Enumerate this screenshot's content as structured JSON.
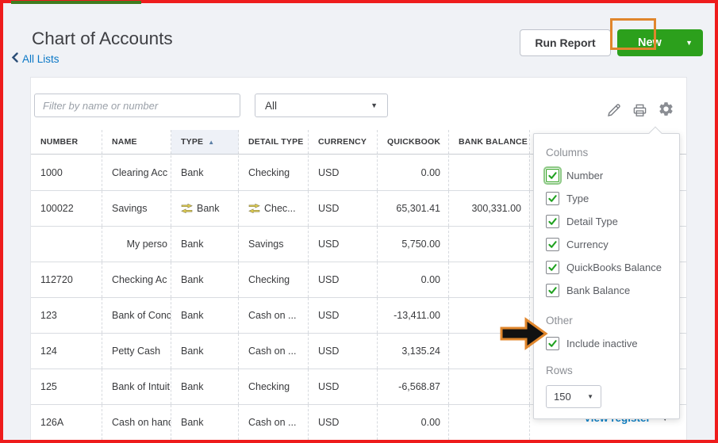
{
  "header": {
    "title": "Chart of Accounts",
    "back_label": "All Lists"
  },
  "toolbar": {
    "run_report_label": "Run Report",
    "new_label": "New"
  },
  "filter_bar": {
    "search_placeholder": "Filter by name or number",
    "filter_select_value": "All"
  },
  "icons": {
    "pencil": "pencil-icon",
    "printer": "printer-icon",
    "gear": "gear-icon",
    "select_arrow": "▼",
    "new_button_arrow": "▼",
    "sort_asc": "▲",
    "view_register_arrow": "▼",
    "rows_select_arrow": "▼"
  },
  "table": {
    "columns": [
      "NUMBER",
      "NAME",
      "TYPE",
      "DETAIL TYPE",
      "CURRENCY",
      "QUICKBOOK",
      "BANK BALANCE"
    ],
    "sorted_column": "TYPE",
    "sort_direction": "asc",
    "rows": [
      {
        "number": "1000",
        "name": "Clearing Acc",
        "type": "Bank",
        "type_synced": false,
        "detail_type": "Checking",
        "detail_synced": false,
        "currency": "USD",
        "quickbooks_balance": "0.00",
        "bank_balance": ""
      },
      {
        "number": "100022",
        "name": "Savings",
        "type": "Bank",
        "type_synced": true,
        "detail_type": "Chec...",
        "detail_synced": true,
        "currency": "USD",
        "quickbooks_balance": "65,301.41",
        "bank_balance": "300,331.00"
      },
      {
        "number": "",
        "name": "My perso",
        "name_align": "right",
        "type": "Bank",
        "type_synced": false,
        "detail_type": "Savings",
        "detail_synced": false,
        "currency": "USD",
        "quickbooks_balance": "5,750.00",
        "bank_balance": ""
      },
      {
        "number": "112720",
        "name": "Checking Ac",
        "type": "Bank",
        "type_synced": false,
        "detail_type": "Checking",
        "detail_synced": false,
        "currency": "USD",
        "quickbooks_balance": "0.00",
        "bank_balance": ""
      },
      {
        "number": "123",
        "name": "Bank of Conc",
        "type": "Bank",
        "type_synced": false,
        "detail_type": "Cash on ...",
        "detail_synced": false,
        "currency": "USD",
        "quickbooks_balance": "-13,411.00",
        "bank_balance": ""
      },
      {
        "number": "124",
        "name": "Petty Cash",
        "type": "Bank",
        "type_synced": false,
        "detail_type": "Cash on ...",
        "detail_synced": false,
        "currency": "USD",
        "quickbooks_balance": "3,135.24",
        "bank_balance": ""
      },
      {
        "number": "125",
        "name": "Bank of Intuit",
        "type": "Bank",
        "type_synced": false,
        "detail_type": "Checking",
        "detail_synced": false,
        "currency": "USD",
        "quickbooks_balance": "-6,568.87",
        "bank_balance": ""
      },
      {
        "number": "126A",
        "name": "Cash on hand",
        "type": "Bank",
        "type_synced": false,
        "detail_type": "Cash on ...",
        "detail_synced": false,
        "currency": "USD",
        "quickbooks_balance": "0.00",
        "bank_balance": ""
      }
    ],
    "row_action_label": "View register"
  },
  "settings_menu": {
    "columns_header": "Columns",
    "column_options": [
      {
        "label": "Number",
        "checked": true,
        "focused": true
      },
      {
        "label": "Type",
        "checked": true
      },
      {
        "label": "Detail Type",
        "checked": true
      },
      {
        "label": "Currency",
        "checked": true
      },
      {
        "label": "QuickBooks Balance",
        "checked": true
      },
      {
        "label": "Bank Balance",
        "checked": true
      }
    ],
    "other_header": "Other",
    "other_options": [
      {
        "label": "Include inactive",
        "checked": true
      }
    ],
    "rows_header": "Rows",
    "rows_value": "150"
  },
  "colors": {
    "brand_green": "#2ca01c",
    "link_blue": "#0077c5",
    "check_green": "#1fa11f",
    "highlight_orange": "#e0862c",
    "frame_red": "#ee1c1c",
    "sort_arrow_blue": "#5b7fa6"
  }
}
